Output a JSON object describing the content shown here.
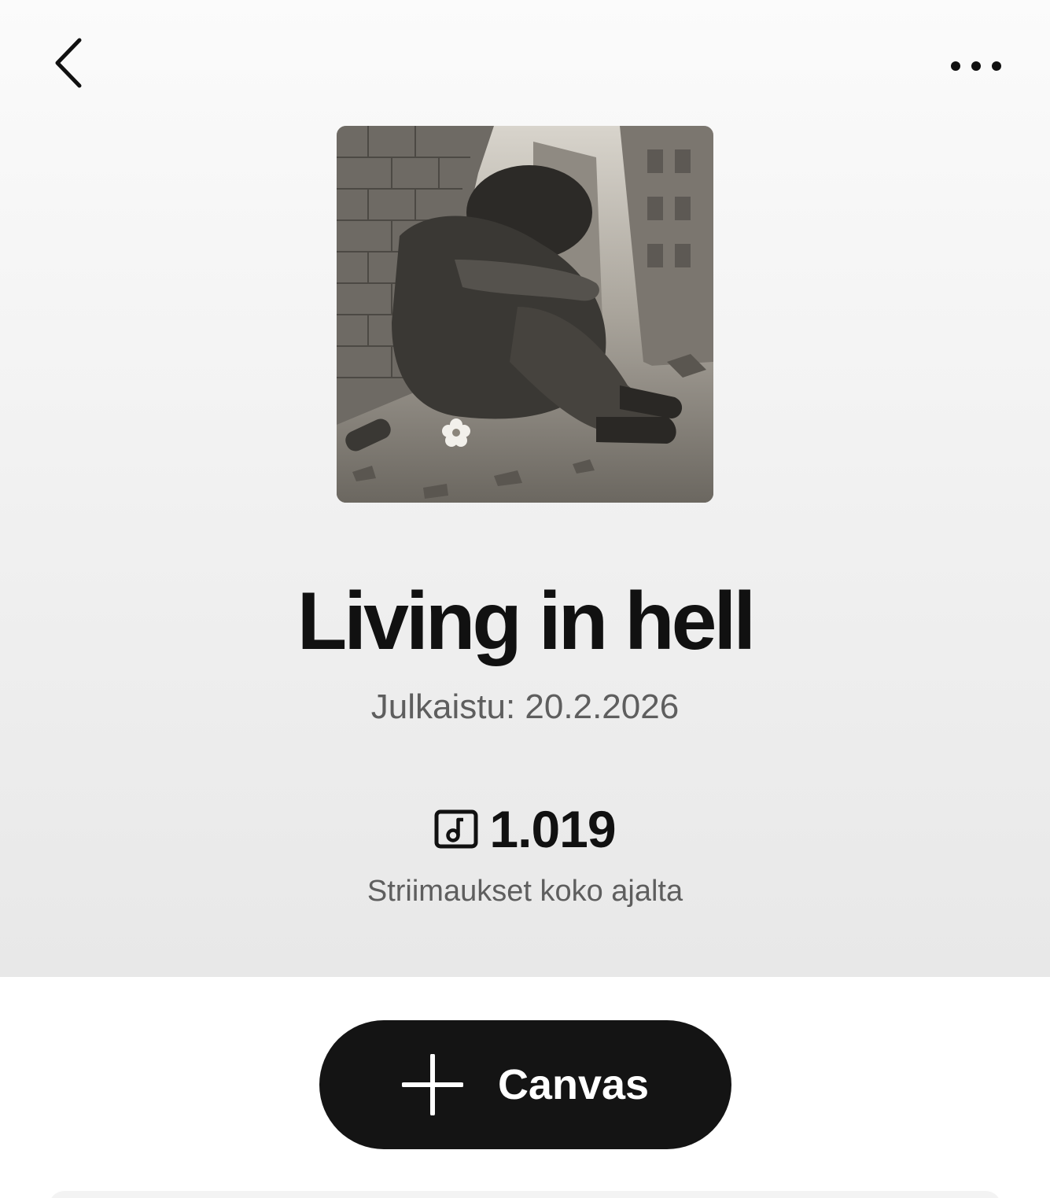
{
  "header": {
    "back_icon": "chevron-left-icon",
    "more_icon": "more-horizontal-icon"
  },
  "track": {
    "cover_alt": "Living in hell",
    "title": "Living in hell",
    "release_text": "Julkaistu: 20.2.2026",
    "streams_icon": "music-note-box-icon",
    "streams_count": "1.019",
    "streams_label": "Striimaukset koko ajalta"
  },
  "actions": {
    "canvas_icon": "plus-icon",
    "canvas_label": "Canvas"
  },
  "colors": {
    "primary_button_bg": "#141414",
    "text_primary": "#111111",
    "text_secondary": "#5e5e5e"
  }
}
